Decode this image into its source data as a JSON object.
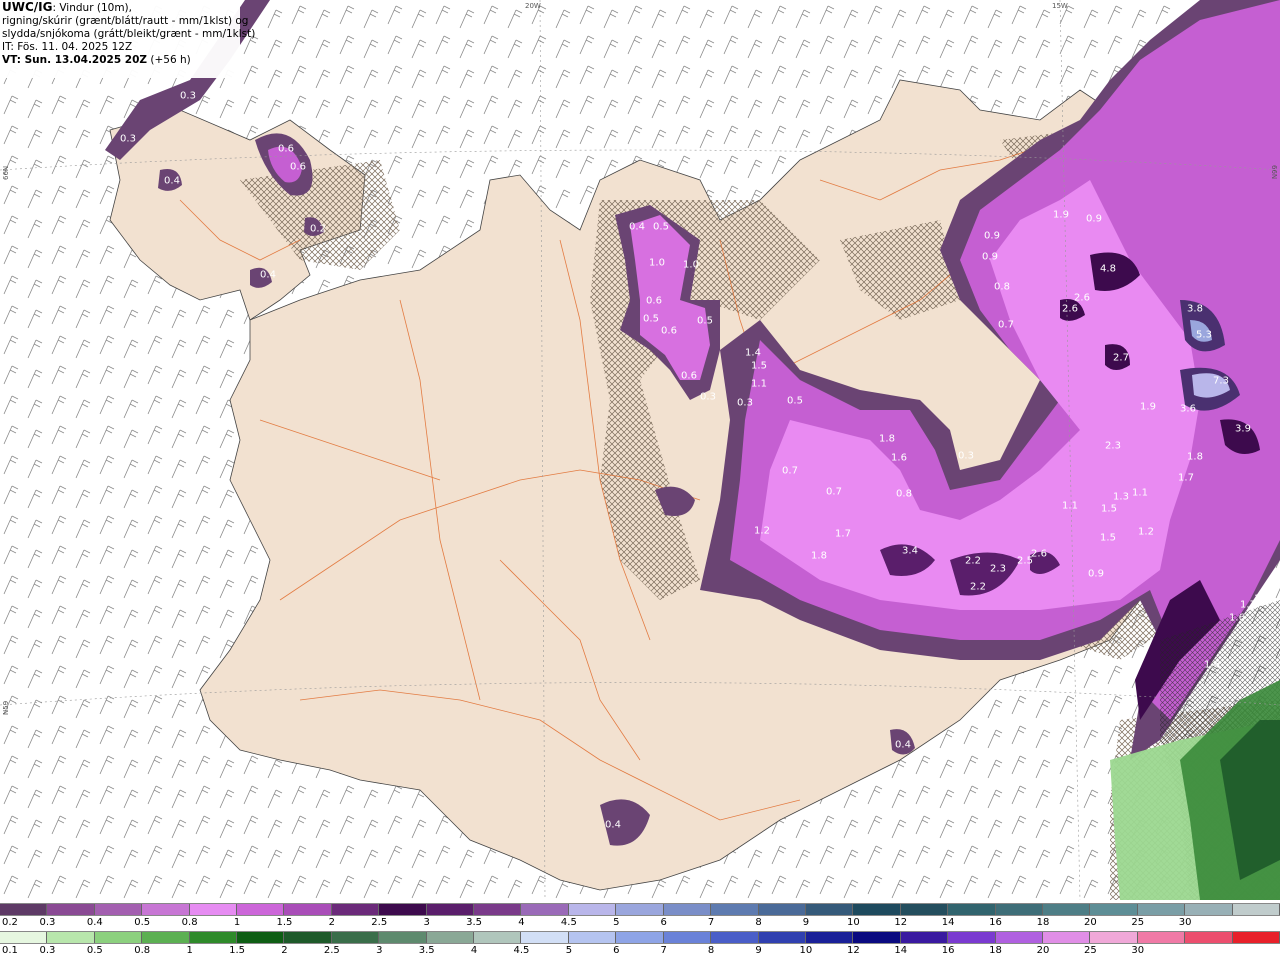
{
  "header": {
    "title_model": "UWC/IG",
    "title_rest": ": Vindur (10m),",
    "line2": "rigning/skúrir (grænt/blátt/rautt - mm/1klst) og",
    "line3": "slydda/snjókoma (grátt/bleikt/grænt - mm/1klst)",
    "line4": "IT: Fös. 11. 04. 2025 12Z",
    "line5_vt": "VT: Sun. 13.04.2025 20Z",
    "line5_lead": " (+56 h)"
  },
  "graticule": {
    "lon_20w": "20W",
    "lon_15w": "15W",
    "lat_left_top": "66N",
    "lat_left_bottom": "N59",
    "lat_right": "66N"
  },
  "snow_labels": [
    "0.3",
    "0.3",
    "0.4",
    "0.6",
    "0.6",
    "0.2",
    "0.4",
    "0.4",
    "0.5",
    "1.0",
    "1.0",
    "0.6",
    "0.5",
    "0.6",
    "0.5",
    "0.6",
    "0.3",
    "1.4",
    "1.5",
    "1.1",
    "0.5",
    "0.3",
    "0.9",
    "0.9",
    "0.8",
    "0.7",
    "1.9",
    "0.9",
    "4.8",
    "2.6",
    "2.6",
    "2.7",
    "3.8",
    "5.3",
    "7.3",
    "3.6",
    "3.9",
    "1.9",
    "2.3",
    "1.8",
    "1.7",
    "1.8",
    "1.6",
    "0.8",
    "0.7",
    "0.7",
    "0.3",
    "1.2",
    "1.8",
    "1.7",
    "3.4",
    "2.2",
    "2.3",
    "2.5",
    "2.6",
    "2.2",
    "1.1",
    "1.3",
    "1.1",
    "1.5",
    "1.2",
    "0.9",
    "1.5",
    "0.4",
    "0.4",
    "1.6",
    "1.7",
    "1.7",
    "1.6"
  ],
  "legend": {
    "snow_colors": [
      "#5e3a66",
      "#8a4a94",
      "#a35fb0",
      "#c776d4",
      "#e68cf2",
      "#cc66d9",
      "#a94db8",
      "#6b2a7a",
      "#3d0a4d",
      "#5a1e6b",
      "#7a3a8a",
      "#9a6ab8",
      "#b9b6ea",
      "#9aa6dd",
      "#7a8ec8",
      "#5e7bb0",
      "#4a6a98",
      "#355a7a",
      "#1e4a5e",
      "#244e5e",
      "#31646e",
      "#3e6e78",
      "#4e7e86",
      "#5e8e96",
      "#7a9ea6",
      "#98b0b6",
      "#c0cccc"
    ],
    "snow_ticks": [
      "0.2",
      "0.3",
      "0.4",
      "0.5",
      "0.8",
      "1",
      "1.5",
      "2",
      "2.5",
      "3",
      "3.5",
      "4",
      "4.5",
      "5",
      "6",
      "7",
      "8",
      "9",
      "10",
      "12",
      "14",
      "16",
      "18",
      "20",
      "25",
      "30"
    ],
    "rain_colors": [
      "#e6f7e0",
      "#b8e6ac",
      "#8cd07e",
      "#5cb052",
      "#2e8a2a",
      "#0e5e14",
      "#1e5a2a",
      "#3a6e4a",
      "#5e8a6e",
      "#8aa896",
      "#b0c6bc",
      "#d2dff6",
      "#b5c4f0",
      "#8ea4e6",
      "#6a82d8",
      "#4a5ec8",
      "#3040b0",
      "#1a2098",
      "#0a0a80",
      "#3a1aa0",
      "#7a3ad0",
      "#b060e0",
      "#e08ee6",
      "#f0a8d8",
      "#f07aa6",
      "#ec4e6e",
      "#e8202a"
    ],
    "rain_ticks": [
      "0.1",
      "0.3",
      "0.5",
      "0.8",
      "1",
      "1.5",
      "2",
      "2.5",
      "3",
      "3.5",
      "4",
      "4.5",
      "5",
      "6",
      "7",
      "8",
      "9",
      "10",
      "12",
      "14",
      "16",
      "18",
      "20",
      "25",
      "30"
    ]
  }
}
